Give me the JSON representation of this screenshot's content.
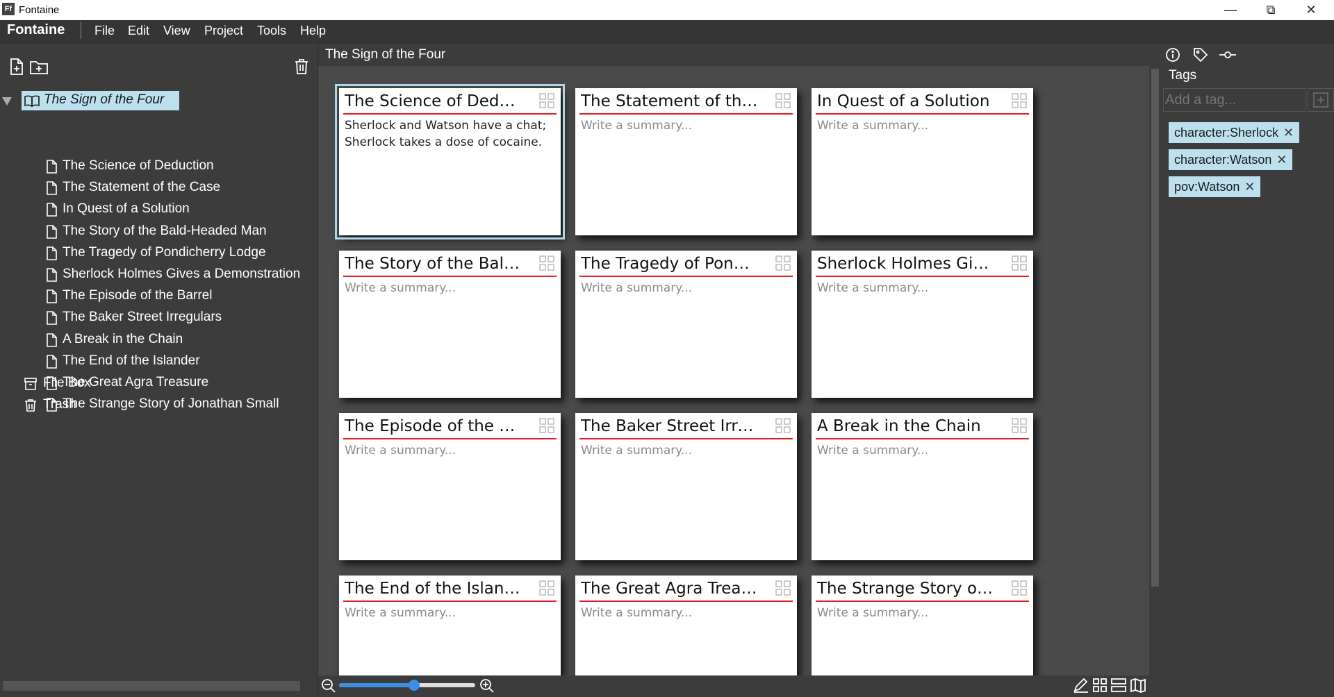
{
  "window": {
    "title": "Fontaine",
    "icon_text": "Ff"
  },
  "menubar": {
    "brand": "Fontaine",
    "items": [
      "File",
      "Edit",
      "View",
      "Project",
      "Tools",
      "Help"
    ]
  },
  "sidebar": {
    "root": "The Sign of the Four",
    "chapters": [
      "The Science of Deduction",
      "The Statement of the Case",
      "In Quest of a Solution",
      "The Story of the Bald-Headed Man",
      "The Tragedy of Pondicherry Lodge",
      "Sherlock Holmes Gives a Demonstration",
      "The Episode of the Barrel",
      "The Baker Street Irregulars",
      "A Break in the Chain",
      "The End of the Islander",
      "The Great Agra Treasure",
      "The Strange Story of Jonathan Small"
    ],
    "file_box": "File Box",
    "trash": "Trash"
  },
  "main": {
    "title": "The Sign of the Four",
    "cards": [
      {
        "title": "The Science of Deduc...",
        "summary": "Sherlock and Watson have a chat; Sherlock takes a dose of cocaine."
      },
      {
        "title": "The Statement of the ...",
        "summary": "Write a summary..."
      },
      {
        "title": "In Quest of a Solution",
        "summary": "Write a summary..."
      },
      {
        "title": "The Story of the Bald-...",
        "summary": "Write a summary..."
      },
      {
        "title": "The Tragedy of Pondi...",
        "summary": "Write a summary..."
      },
      {
        "title": "Sherlock Holmes Give...",
        "summary": "Write a summary..."
      },
      {
        "title": "The Episode of the Ba...",
        "summary": "Write a summary..."
      },
      {
        "title": "The Baker Street Irre...",
        "summary": "Write a summary..."
      },
      {
        "title": "A Break in the Chain",
        "summary": "Write a summary..."
      },
      {
        "title": "The End of the Islander",
        "summary": "Write a summary..."
      },
      {
        "title": "The Great Agra Treas...",
        "summary": "Write a summary..."
      },
      {
        "title": "The Strange Story of J...",
        "summary": "Write a summary..."
      }
    ],
    "zoom_level": 0.55
  },
  "right_panel": {
    "tags_title": "Tags",
    "tag_placeholder": "Add a tag...",
    "tags": [
      "character:Sherlock",
      "character:Watson",
      "pov:Watson"
    ]
  },
  "colors": {
    "accent": "#bde0ee",
    "slider": "#3a8ee6",
    "card_rule": "#e02020"
  }
}
